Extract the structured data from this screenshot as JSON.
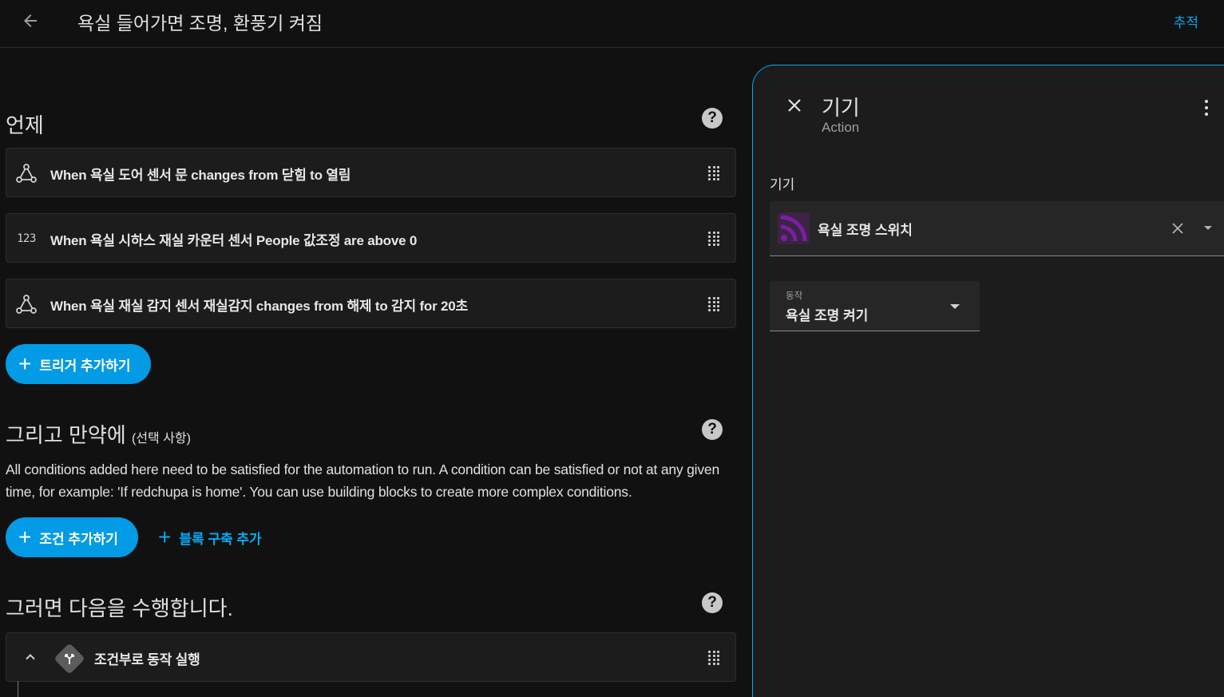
{
  "header": {
    "title": "욕실 들어가면 조명, 환풍기 켜짐",
    "track_label": "추적"
  },
  "triggers": {
    "title": "언제",
    "items": [
      {
        "icon": "state-trigger-icon",
        "label": "When 욕실 도어 센서 문 changes from 닫힘 to 열림"
      },
      {
        "icon": "numeric-trigger-icon",
        "icon_text": "123",
        "label": "When 욕실 시하스 재실 카운터 센서 People 값조정 are above 0"
      },
      {
        "icon": "state-trigger-icon",
        "label": "When 욕실 재실 감지 센서 재실감지 changes from 해제 to 감지 for 20초"
      }
    ],
    "add_label": "트리거 추가하기"
  },
  "conditions": {
    "title": "그리고 만약에",
    "optional": "(선택 사항)",
    "description": "All conditions added here need to be satisfied for the automation to run. A condition can be satisfied or not at any given time, for example: 'If redchupa is home'. You can use building blocks to create more complex conditions.",
    "add_label": "조건 추가하기",
    "add_block_label": "블록 구축 추가"
  },
  "actions": {
    "title": "그러면 다음을 수행합니다.",
    "items": [
      {
        "icon": "choose-icon",
        "label": "조건부로 동작 실행"
      }
    ]
  },
  "panel": {
    "title": "기기",
    "subtitle": "Action",
    "device_label": "기기",
    "device_name": "욕실 조명 스위치",
    "action_field_label": "동작",
    "action_value": "욕실 조명 켜기"
  },
  "colors": {
    "accent": "#03a9f4",
    "button": "#039be5",
    "device_icon": "#7b1fa2"
  }
}
